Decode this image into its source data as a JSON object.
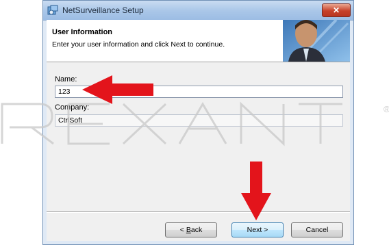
{
  "window": {
    "title": "NetSurveillance Setup",
    "close_symbol": "✕"
  },
  "header": {
    "title": "User Information",
    "subtitle": "Enter your user information and click Next to continue."
  },
  "form": {
    "name_label": "Name:",
    "name_value": "123",
    "company_label": "Company:",
    "company_value": "CtrlSoft"
  },
  "buttons": {
    "back_label": "Back",
    "back_accel": "B",
    "next_label": "Next >",
    "cancel_label": "Cancel"
  },
  "watermark": {
    "text": "REXANT",
    "registered": "®"
  },
  "annotations": {
    "arrow_color": "#e3141b"
  },
  "icons": {
    "app": "setup-icon",
    "close": "close-icon",
    "arrow_left": "red-arrow-left-icon",
    "arrow_down": "red-arrow-down-icon"
  }
}
